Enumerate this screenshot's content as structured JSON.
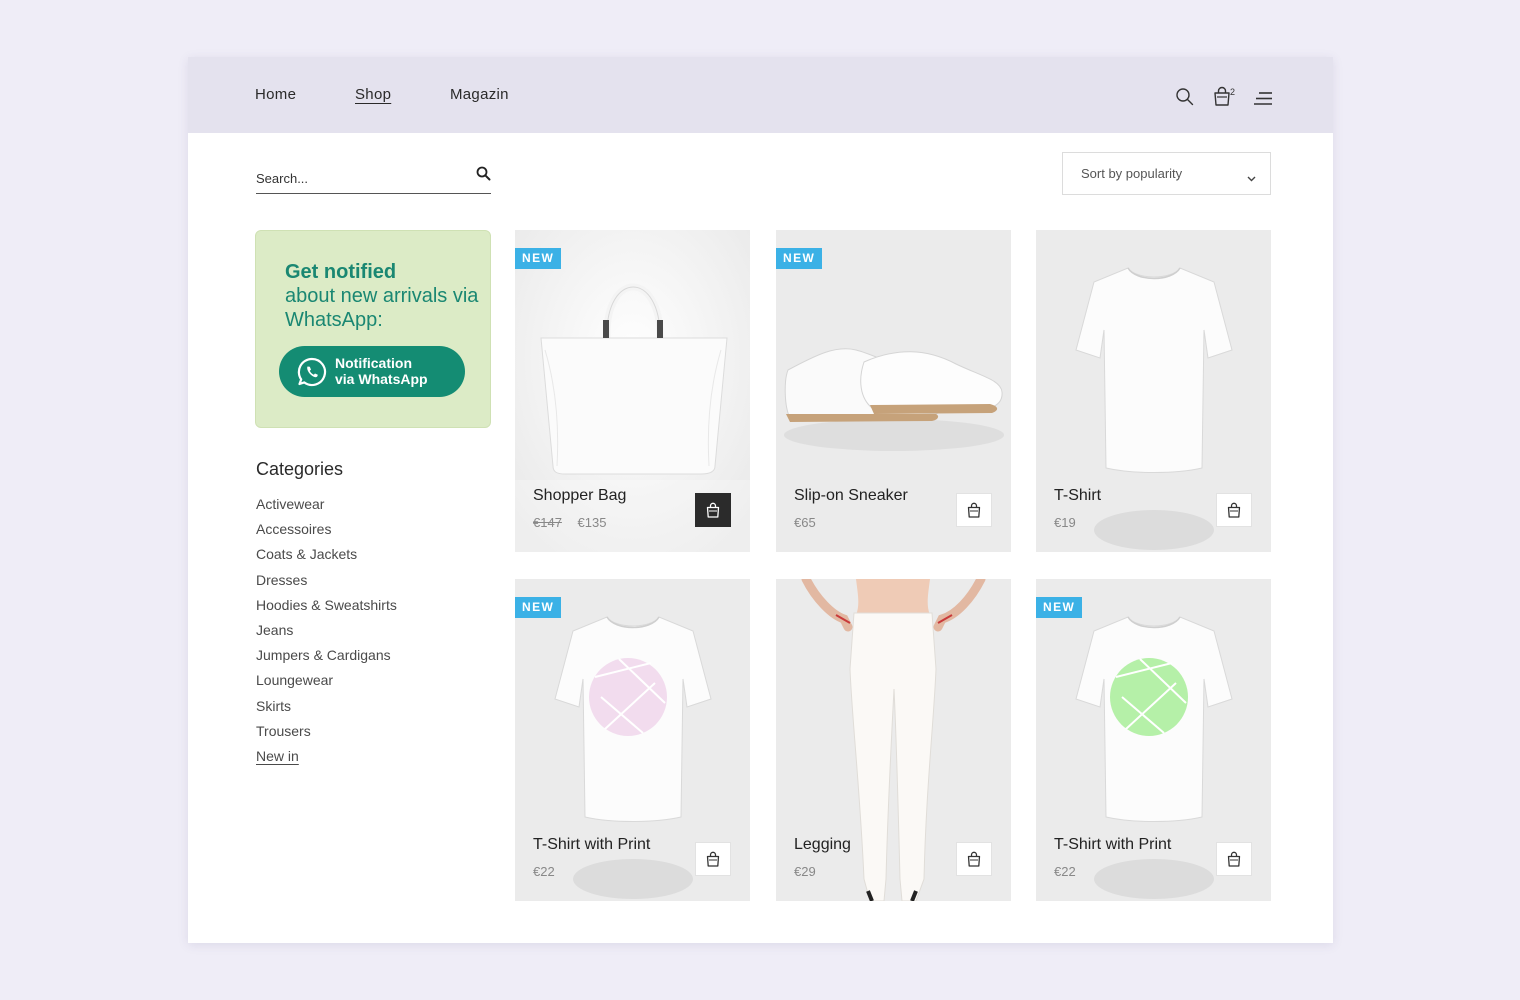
{
  "nav": {
    "home": "Home",
    "shop": "Shop",
    "magazin": "Magazin",
    "cart_count": "2"
  },
  "search": {
    "placeholder": "Search..."
  },
  "sort": {
    "label": "Sort by popularity"
  },
  "promo": {
    "headline_strong": "Get notified",
    "headline_rest": "about new arrivals via WhatsApp:",
    "button_line1": "Notification",
    "button_line2": "via WhatsApp"
  },
  "categories": {
    "title": "Categories",
    "items": [
      "Activewear",
      "Accessoires",
      "Coats & Jackets",
      "Dresses",
      "Hoodies & Sweatshirts",
      "Jeans",
      "Jumpers & Cardigans",
      "Loungewear",
      "Skirts",
      "Trousers",
      "New in"
    ]
  },
  "products": [
    {
      "name": "Shopper Bag",
      "old_price": "€147",
      "price": "€135",
      "badge": "NEW"
    },
    {
      "name": "Slip-on Sneaker",
      "old_price": "",
      "price": "€65",
      "badge": "NEW"
    },
    {
      "name": "T-Shirt",
      "old_price": "",
      "price": "€19",
      "badge": ""
    },
    {
      "name": "T-Shirt with Print",
      "old_price": "",
      "price": "€22",
      "badge": "NEW"
    },
    {
      "name": "Legging",
      "old_price": "",
      "price": "€29",
      "badge": ""
    },
    {
      "name": "T-Shirt with Print",
      "old_price": "",
      "price": "€22",
      "badge": "NEW"
    }
  ],
  "colors": {
    "accent_green": "#148c73",
    "promo_bg": "#dcebc6",
    "badge_blue": "#3bb1e6",
    "print_pink": "#f2dcee",
    "print_green": "#b5f0a8"
  }
}
